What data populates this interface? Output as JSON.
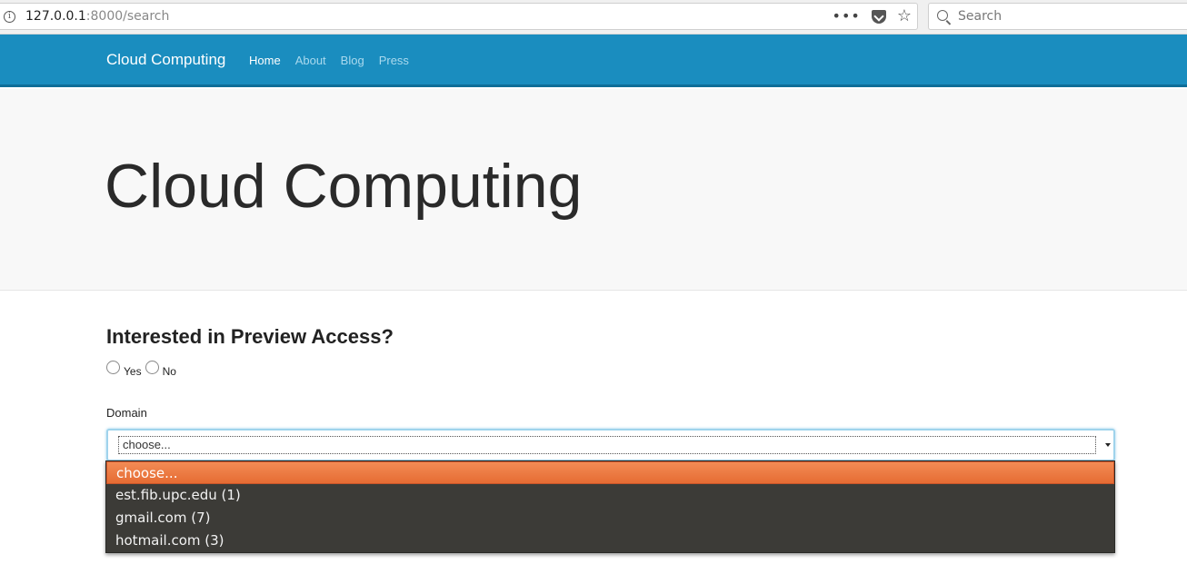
{
  "browser": {
    "url_host": "127.0.0.1",
    "url_rest": ":8000/search",
    "search_placeholder": "Search"
  },
  "navbar": {
    "brand": "Cloud Computing",
    "links": [
      "Home",
      "About",
      "Blog",
      "Press"
    ],
    "active": "Home"
  },
  "jumbotron": {
    "title": "Cloud Computing"
  },
  "form": {
    "heading": "Interested in Preview Access?",
    "radio_yes": "Yes",
    "radio_no": "No",
    "domain_label": "Domain",
    "select_value": "choose...",
    "options": [
      "choose...",
      "est.fib.upc.edu (1)",
      "gmail.com (7)",
      "hotmail.com (3)"
    ]
  },
  "colors": {
    "navbar": "#1a8dbf",
    "highlight": "#e9703a",
    "dropdown_bg": "#3c3b37"
  }
}
